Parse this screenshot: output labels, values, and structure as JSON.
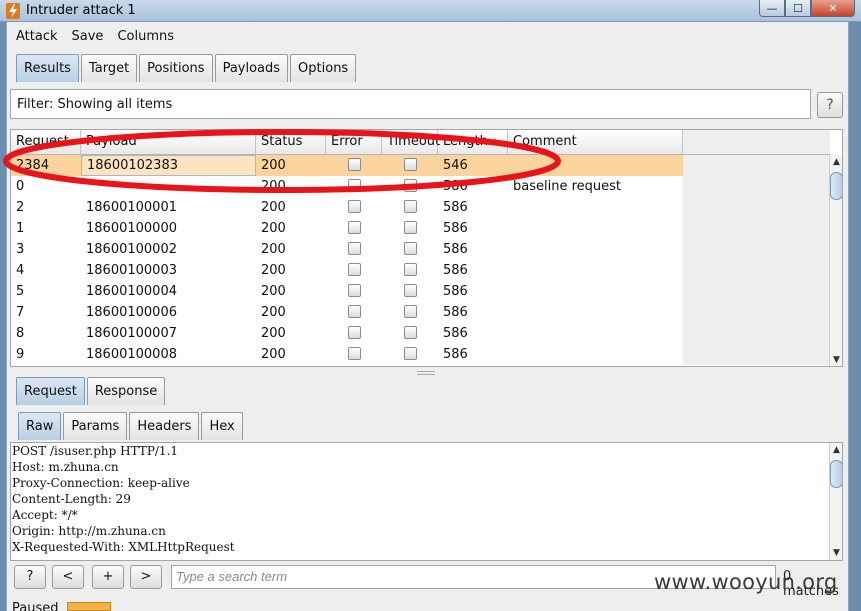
{
  "window": {
    "title": "Intruder attack 1",
    "min": "—",
    "max": "☐",
    "close": "✕"
  },
  "menu": [
    "Attack",
    "Save",
    "Columns"
  ],
  "main_tabs": [
    "Results",
    "Target",
    "Positions",
    "Payloads",
    "Options"
  ],
  "filter": {
    "text": "Filter: Showing all items",
    "help": "?"
  },
  "table": {
    "columns": [
      "Request",
      "Payload",
      "Status",
      "Error",
      "Timeout",
      "Length",
      "Comment"
    ],
    "rows": [
      {
        "request": "2384",
        "payload": "18600102383",
        "status": "200",
        "length": "546",
        "comment": "",
        "selected": true
      },
      {
        "request": "0",
        "payload": "",
        "status": "200",
        "length": "586",
        "comment": "baseline request"
      },
      {
        "request": "2",
        "payload": "18600100001",
        "status": "200",
        "length": "586",
        "comment": ""
      },
      {
        "request": "1",
        "payload": "18600100000",
        "status": "200",
        "length": "586",
        "comment": ""
      },
      {
        "request": "3",
        "payload": "18600100002",
        "status": "200",
        "length": "586",
        "comment": ""
      },
      {
        "request": "4",
        "payload": "18600100003",
        "status": "200",
        "length": "586",
        "comment": ""
      },
      {
        "request": "5",
        "payload": "18600100004",
        "status": "200",
        "length": "586",
        "comment": ""
      },
      {
        "request": "7",
        "payload": "18600100006",
        "status": "200",
        "length": "586",
        "comment": ""
      },
      {
        "request": "8",
        "payload": "18600100007",
        "status": "200",
        "length": "586",
        "comment": ""
      },
      {
        "request": "9",
        "payload": "18600100008",
        "status": "200",
        "length": "586",
        "comment": ""
      }
    ]
  },
  "message_tabs": [
    "Request",
    "Response"
  ],
  "view_tabs": [
    "Raw",
    "Params",
    "Headers",
    "Hex"
  ],
  "raw_lines": [
    "POST /isuser.php HTTP/1.1",
    "Host: m.zhuna.cn",
    "Proxy-Connection: keep-alive",
    "Content-Length: 29",
    "Accept: */*",
    "Origin: http://m.zhuna.cn",
    "X-Requested-With: XMLHttpRequest"
  ],
  "search": {
    "help": "?",
    "prev": "<",
    "add": "+",
    "next": ">",
    "placeholder": "Type a search term",
    "matches": "0 matches"
  },
  "status": {
    "text": "Paused",
    "progress": 0.03
  },
  "watermark": "www.wooyun.org",
  "colors": {
    "selected_row": "#fbd39c",
    "highlight": "#e8141a",
    "progress": "#f2b14a"
  }
}
